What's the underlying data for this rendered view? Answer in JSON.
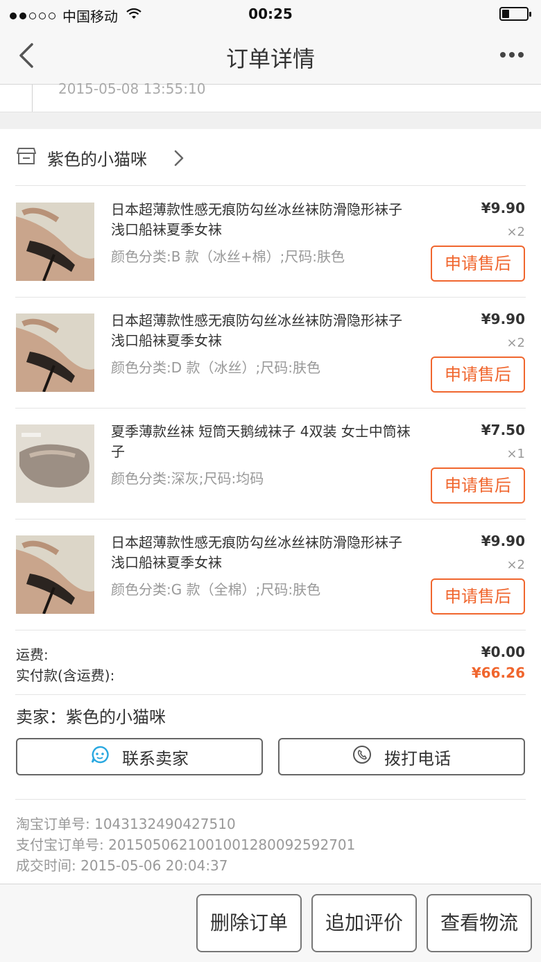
{
  "status_bar": {
    "carrier": "中国移动",
    "time": "00:25",
    "battery_level": 0.3
  },
  "nav": {
    "title": "订单详情"
  },
  "prev_section": {
    "timestamp": "2015-05-08 13:55:10"
  },
  "shop": {
    "name": "紫色的小猫咪"
  },
  "items": [
    {
      "name": "日本超薄款性感无痕防勾丝冰丝袜防滑隐形袜子 浅口船袜夏季女袜",
      "spec": "颜色分类:B 款（冰丝+棉）;尺码:肤色",
      "price": "¥9.90",
      "qty": "×2",
      "action": "申请售后"
    },
    {
      "name": "日本超薄款性感无痕防勾丝冰丝袜防滑隐形袜子 浅口船袜夏季女袜",
      "spec": "颜色分类:D 款（冰丝）;尺码:肤色",
      "price": "¥9.90",
      "qty": "×2",
      "action": "申请售后"
    },
    {
      "name": "夏季薄款丝袜 短筒天鹅绒袜子 4双装 女士中筒袜子",
      "spec": "颜色分类:深灰;尺码:均码",
      "price": "¥7.50",
      "qty": "×1",
      "action": "申请售后"
    },
    {
      "name": "日本超薄款性感无痕防勾丝冰丝袜防滑隐形袜子 浅口船袜夏季女袜",
      "spec": "颜色分类:G 款（全棉）;尺码:肤色",
      "price": "¥9.90",
      "qty": "×2",
      "action": "申请售后"
    }
  ],
  "fees": {
    "shipping_label": "运费:",
    "shipping_value": "¥0.00",
    "total_label": "实付款(含运费):",
    "total_value": "¥66.26"
  },
  "seller": {
    "label": "卖家：紫色的小猫咪",
    "contact_label": "联系卖家",
    "call_label": "拨打电话"
  },
  "order_info": {
    "taobao_no": "淘宝订单号: 1043132490427510",
    "alipay_no": "支付宝订单号: 2015050621001001280092592701",
    "deal_time": "成交时间: 2015-05-06 20:04:37"
  },
  "bottom_actions": {
    "delete": "删除订单",
    "review": "追加评价",
    "logistics": "查看物流"
  },
  "colors": {
    "accent": "#f0662e",
    "contact_icon": "#29a8e0"
  }
}
